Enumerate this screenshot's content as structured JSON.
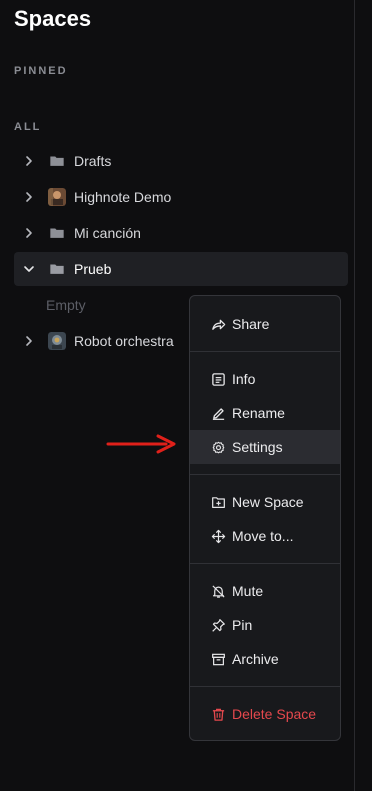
{
  "page": {
    "title": "Spaces"
  },
  "sections": {
    "pinned": "PINNED",
    "all": "ALL"
  },
  "spaces": [
    {
      "label": "Drafts",
      "icon": "folder-icon",
      "expanded": false
    },
    {
      "label": "Highnote Demo",
      "icon": "thumbnail-image",
      "expanded": false
    },
    {
      "label": "Mi canción",
      "icon": "folder-icon",
      "expanded": false
    },
    {
      "label": "Prueb",
      "icon": "folder-icon",
      "expanded": true,
      "selected": true
    },
    {
      "label": "Robot orchestra",
      "icon": "thumbnail-image",
      "expanded": false
    }
  ],
  "empty_label": "Empty",
  "context_menu": {
    "share": "Share",
    "info": "Info",
    "rename": "Rename",
    "settings": "Settings",
    "new_space": "New Space",
    "move_to": "Move to...",
    "mute": "Mute",
    "pin": "Pin",
    "archive": "Archive",
    "delete_space": "Delete Space"
  },
  "colors": {
    "background": "#0e0e10",
    "menu_background": "#18191c",
    "hover": "#2b2c31",
    "danger": "#e5484d",
    "annotation_arrow": "#e0201a"
  }
}
